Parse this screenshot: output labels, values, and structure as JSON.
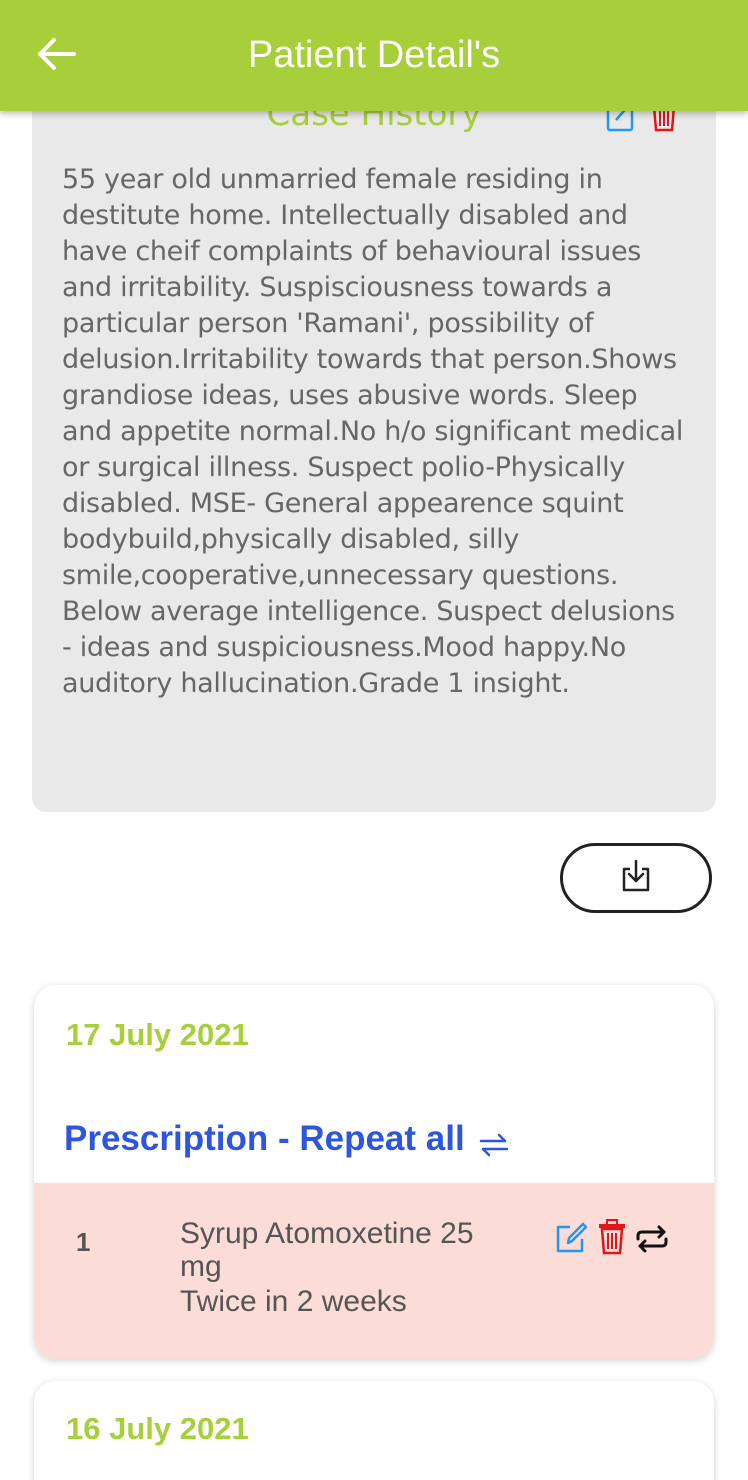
{
  "header": {
    "title": "Patient Detail's",
    "back_icon": "arrow-left-icon"
  },
  "case_history": {
    "title": "Case History",
    "text": "55 year old unmarried female residing in destitute home. Intellectually disabled and have cheif complaints of behavioural issues and irritability. Suspisciousness towards a particular person 'Ramani', possibility of delusion.Irritability towards that person.Shows grandiose ideas, uses abusive words. Sleep and appetite normal.No h/o significant medical or surgical illness. Suspect polio-Physically disabled. MSE- General appearence squint bodybuild,physically disabled, silly smile,cooperative,unnecessary questions. Below average intelligence. Suspect delusions - ideas and suspiciousness.Mood happy.No auditory hallucination.Grade 1 insight.",
    "edit_icon": "edit-icon",
    "delete_icon": "trash-icon"
  },
  "download": {
    "icon": "download-icon"
  },
  "prescriptions": [
    {
      "date": "17 July 2021",
      "heading": "Prescription - Repeat all",
      "items": [
        {
          "number": "1",
          "medicine": "Syrup Atomoxetine 25 mg",
          "frequency": "Twice in 2 weeks"
        }
      ]
    },
    {
      "date": "16 July 2021"
    }
  ],
  "colors": {
    "brand_green": "#a6cf3a",
    "link_blue": "#2e55de",
    "delete_red": "#e0161b",
    "row_pink": "#fcdcd6",
    "edit_blue": "#2196f3"
  }
}
